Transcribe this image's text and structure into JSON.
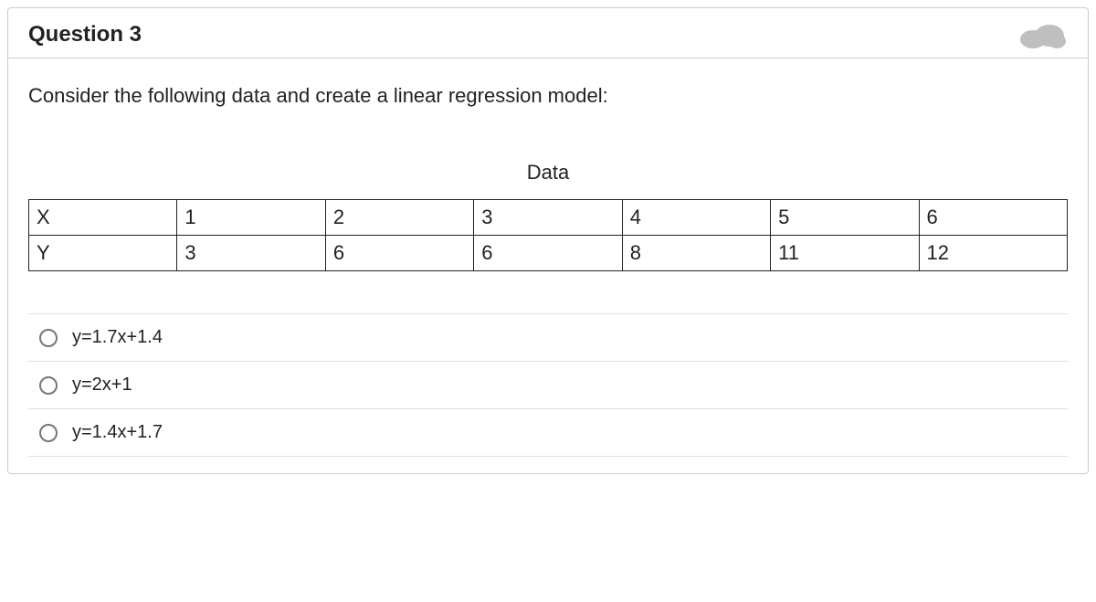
{
  "question": {
    "title": "Question 3",
    "prompt": "Consider the following data and create a linear regression model:"
  },
  "table": {
    "caption": "Data",
    "rows": [
      {
        "label": "X",
        "values": [
          "1",
          "2",
          "3",
          "4",
          "5",
          "6"
        ]
      },
      {
        "label": "Y",
        "values": [
          "3",
          "6",
          "6",
          "8",
          "11",
          "12"
        ]
      }
    ]
  },
  "options": [
    {
      "text": "y=1.7x+1.4"
    },
    {
      "text": "y=2x+1"
    },
    {
      "text": "y=1.4x+1.7"
    }
  ],
  "chart_data": {
    "type": "table",
    "title": "Data",
    "series": [
      {
        "name": "X",
        "values": [
          1,
          2,
          3,
          4,
          5,
          6
        ]
      },
      {
        "name": "Y",
        "values": [
          3,
          6,
          6,
          8,
          11,
          12
        ]
      }
    ]
  }
}
